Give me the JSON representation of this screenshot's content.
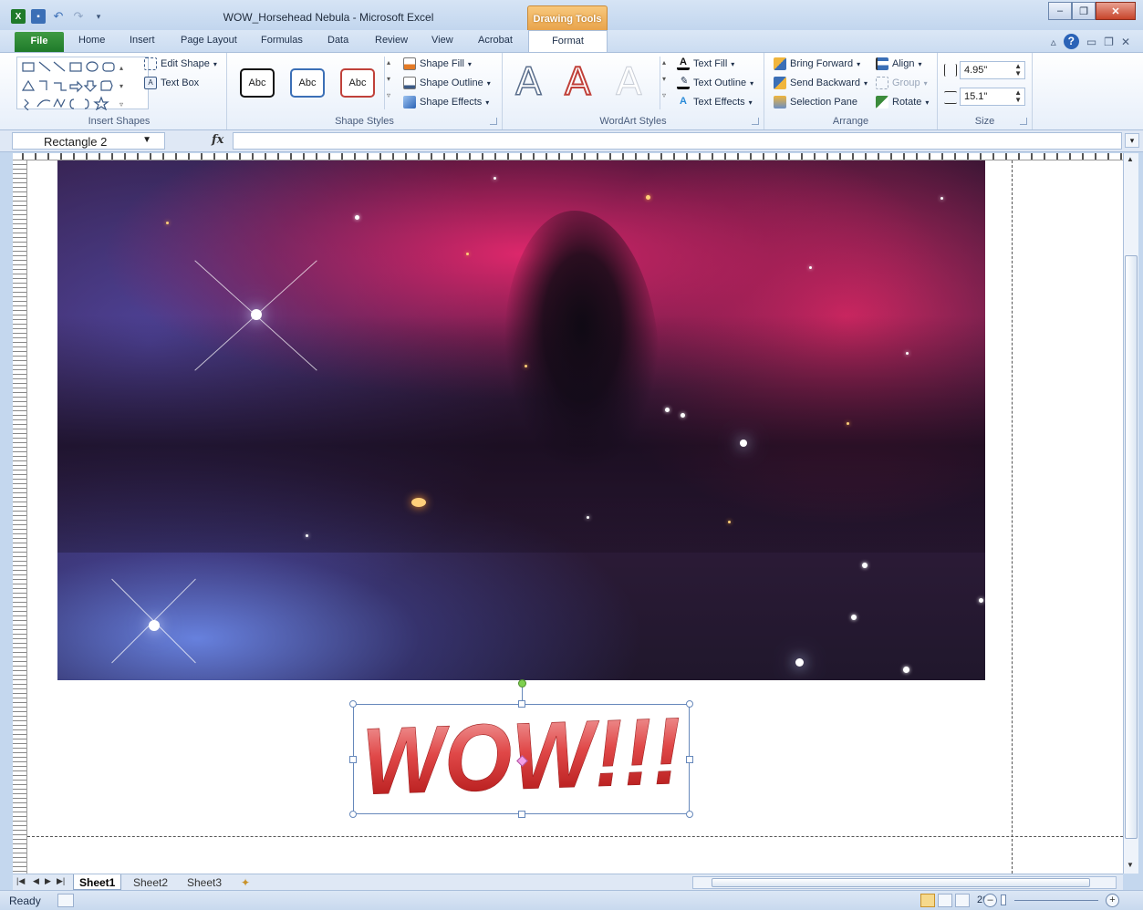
{
  "app": {
    "window_title": "WOW_Horsehead Nebula  -  Microsoft Excel",
    "context_tab_group": "Drawing Tools"
  },
  "tabs": [
    "File",
    "Home",
    "Insert",
    "Page Layout",
    "Formulas",
    "Data",
    "Review",
    "View",
    "Acrobat",
    "Format"
  ],
  "ribbon": {
    "insert_shapes": {
      "label": "Insert Shapes",
      "edit_shape": "Edit Shape",
      "text_box": "Text Box"
    },
    "shape_styles": {
      "label": "Shape Styles",
      "swatch_text": "Abc",
      "shape_fill": "Shape Fill",
      "shape_outline": "Shape Outline",
      "shape_effects": "Shape Effects"
    },
    "wordart_styles": {
      "label": "WordArt Styles",
      "wordart_glyph": "A",
      "text_fill": "Text Fill",
      "text_outline": "Text Outline",
      "text_effects": "Text Effects"
    },
    "arrange": {
      "label": "Arrange",
      "bring_forward": "Bring Forward",
      "send_backward": "Send Backward",
      "selection_pane": "Selection Pane",
      "align": "Align",
      "group": "Group",
      "rotate": "Rotate"
    },
    "size": {
      "label": "Size",
      "height": "4.95\"",
      "width": "15.1\""
    }
  },
  "formula_bar": {
    "name_box": "Rectangle 2",
    "fx": "fx",
    "formula": ""
  },
  "canvas": {
    "wordart_text": "WOW!!!"
  },
  "sheet_tabs": [
    "Sheet1",
    "Sheet2",
    "Sheet3"
  ],
  "status": {
    "ready": "Ready",
    "zoom": "26%"
  },
  "colors": {
    "accent": "#2b63b7",
    "file_tab": "#1f7a2a",
    "context_tab": "#e8a249",
    "wordart_red": "#d42a2a"
  },
  "icons": [
    "excel-logo-icon",
    "save-icon",
    "undo-icon",
    "redo-icon",
    "help-icon",
    "minimize-icon",
    "restore-icon",
    "close-icon"
  ]
}
